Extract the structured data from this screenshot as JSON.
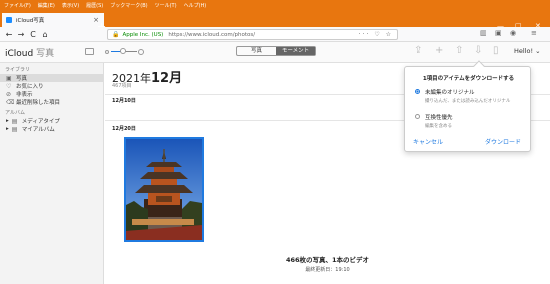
{
  "menubar": [
    "ファイル(F)",
    "編集(E)",
    "表示(V)",
    "履歴(S)",
    "ブックマーク(B)",
    "ツール(T)",
    "ヘルプ(H)"
  ],
  "tab": {
    "title": "iCloud写真",
    "close": "×",
    "new": "+"
  },
  "window_controls": {
    "minimize": "—",
    "maximize": "□",
    "close": "✕"
  },
  "nav": {
    "back": "←",
    "forward": "→",
    "reload": "C",
    "home": "⌂"
  },
  "urlbar": {
    "cert": "Apple Inc. (US)",
    "url": "https://www.icloud.com/photos/",
    "icons": "··· ♡ ☆"
  },
  "toolbar_icons": {
    "library": "▥",
    "reader": "▣",
    "account": "◉",
    "menu": "≡"
  },
  "app": {
    "brand": "iCloud",
    "brand_sub": "写真",
    "segments": [
      "写真",
      "モーメント"
    ],
    "selected_segment": 1,
    "zoom_level": 0.45,
    "hello": "Hello!",
    "hello_caret": "⌄",
    "icons": {
      "upload": "⇪",
      "add": "+",
      "share": "⇧",
      "download": "⇩",
      "trash": "▯"
    }
  },
  "sidebar": {
    "library_header": "ライブラリ",
    "library_items": [
      {
        "icon": "▣",
        "label": "写真",
        "selected": true
      },
      {
        "icon": "♡",
        "label": "お気に入り"
      },
      {
        "icon": "⊘",
        "label": "非表示"
      },
      {
        "icon": "⌫",
        "label": "最近削除した項目"
      }
    ],
    "albums_header": "アルバム",
    "album_items": [
      {
        "arrow": "▸",
        "icon": "▤",
        "label": "メディアタイプ"
      },
      {
        "arrow": "▸",
        "icon": "▤",
        "label": "マイアルバム"
      }
    ]
  },
  "main": {
    "year": "2021年",
    "month": "12月",
    "count": "467項目",
    "date1": "12月10日",
    "date2": "12月20日",
    "summary": "466枚の写真、1本のビデオ",
    "updated": "最終更新日：19:10"
  },
  "popover": {
    "title": "1項目のアイテムをダウンロードする",
    "options": [
      {
        "label": "未編集のオリジナル",
        "desc": "撮り込んだ、または読み込んだオリジナル",
        "selected": true
      },
      {
        "label": "互換性優先",
        "desc": "編集を含める",
        "selected": false
      }
    ],
    "cancel": "キャンセル",
    "download": "ダウンロード"
  },
  "colors": {
    "firefox_orange": "#e8760f",
    "accent": "#1f7ae0"
  }
}
